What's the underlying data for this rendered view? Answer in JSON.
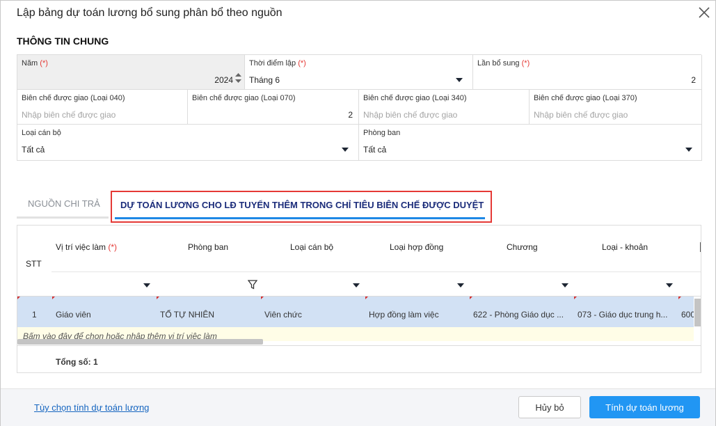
{
  "dialog": {
    "title": "Lập bảng dự toán lương bổ sung phân bổ theo nguồn"
  },
  "general": {
    "section_title": "THÔNG TIN CHUNG",
    "year": {
      "label": "Năm",
      "required": "(*)",
      "value": "2024"
    },
    "time": {
      "label": "Thời điểm lập",
      "required": "(*)",
      "value": "Tháng 6"
    },
    "supplement": {
      "label": "Lần bổ sung",
      "required": "(*)",
      "value": "2"
    },
    "quota_040": {
      "label": "Biên chế được giao (Loại 040)",
      "placeholder": "Nhập biên chế được giao"
    },
    "quota_070": {
      "label": "Biên chế được giao (Loại 070)",
      "value": "2"
    },
    "quota_340": {
      "label": "Biên chế được giao (Loại 340)",
      "placeholder": "Nhập biên chế được giao"
    },
    "quota_370": {
      "label": "Biên chế được giao (Loại 370)",
      "placeholder": "Nhập biên chế được giao"
    },
    "staff_type": {
      "label": "Loại cán bộ",
      "value": "Tất cả"
    },
    "department": {
      "label": "Phòng ban",
      "value": "Tất cả"
    }
  },
  "tabs": [
    {
      "label": "NGUỒN CHI TRẢ",
      "active": false
    },
    {
      "label": "DỰ TOÁN LƯƠNG CHO LĐ TUYỂN THÊM TRONG CHỈ TIÊU BIÊN CHẾ ĐƯỢC DUYỆT",
      "active": true
    }
  ],
  "table": {
    "headers": {
      "stt": "STT",
      "position": "Vị trí việc làm",
      "position_required": "(*)",
      "department": "Phòng ban",
      "staff_type": "Loại cán bộ",
      "contract": "Loại hợp đồng",
      "chapter": "Chương",
      "category": "Loại - khoản"
    },
    "rows": [
      {
        "stt": "1",
        "position": "Giáo viên",
        "department": "TỔ TỰ NHIÊN",
        "staff_type": "Viên chức",
        "contract": "Hợp đồng làm việc",
        "chapter": "622 - Phòng Giáo dục ...",
        "category": "073 - Giáo dục trung h...",
        "extra": "600"
      }
    ],
    "add_row_hint": "Bấm vào đây để chọn hoặc nhập thêm vị trí việc làm",
    "total_label": "Tổng số: 1"
  },
  "footer": {
    "options_link": "Tùy chọn tính dự toán lương",
    "cancel": "Hủy bỏ",
    "calculate": "Tính dự toán lương"
  },
  "colors": {
    "primary": "#2196f3",
    "highlight_border": "#e53935",
    "selected_row": "#d2e1f4",
    "required": "#e53935"
  }
}
